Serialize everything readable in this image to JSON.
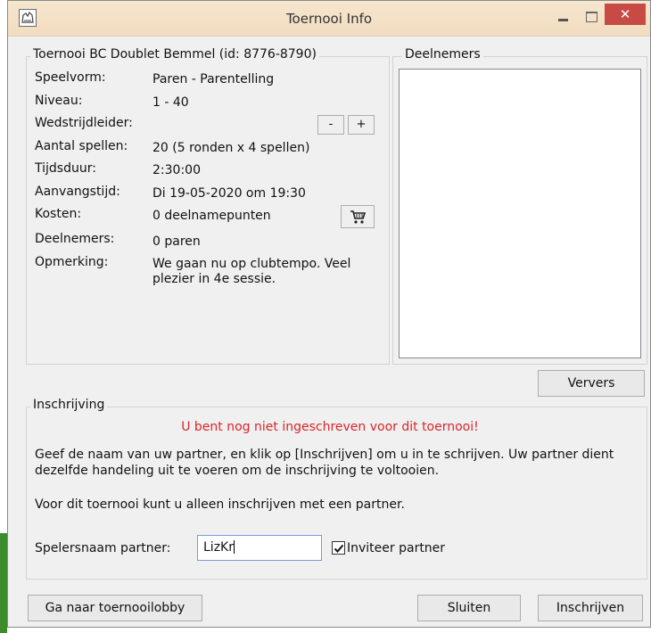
{
  "window": {
    "title": "Toernooi Info"
  },
  "info": {
    "legend": "Toernooi BC Doublet Bemmel (id: 8776-8790)",
    "rows": [
      {
        "label": "Speelvorm:",
        "value": "Paren - Parentelling"
      },
      {
        "label": "Niveau:",
        "value": "1 - 40"
      },
      {
        "label": "Wedstrijdleider:",
        "value": ""
      },
      {
        "label": "Aantal spellen:",
        "value": "20 (5 ronden x 4 spellen)"
      },
      {
        "label": "Tijdsduur:",
        "value": "2:30:00"
      },
      {
        "label": "Aanvangstijd:",
        "value": "Di 19-05-2020 om 19:30"
      },
      {
        "label": "Kosten:",
        "value": "0 deelnamepunten"
      },
      {
        "label": "Deelnemers:",
        "value": "0 paren"
      },
      {
        "label": "Opmerking:",
        "value": "We gaan nu op clubtempo. Veel plezier in 4e sessie."
      }
    ],
    "minus_label": "-",
    "plus_label": "+"
  },
  "participants": {
    "legend": "Deelnemers",
    "refresh_label": "Ververs"
  },
  "registration": {
    "legend": "Inschrijving",
    "warning": "U bent nog niet ingeschreven voor dit toernooi!",
    "instructions": "Geef de naam van uw partner, en klik op [Inschrijven] om u in te schrijven. Uw partner dient dezelfde handeling uit te voeren om de inschrijving te voltooien.",
    "note": "Voor dit toernooi kunt u alleen inschrijven met een partner.",
    "partner_label": "Spelersnaam partner:",
    "partner_value": "LizKr",
    "invite_label": "Inviteer partner",
    "invite_checked": true
  },
  "footer": {
    "lobby_label": "Ga naar toernooilobby",
    "close_label": "Sluiten",
    "register_label": "Inschrijven"
  },
  "colors": {
    "titlebar": "#f3e2c8",
    "close_button": "#c74b44",
    "warning_text": "#d9262b"
  },
  "icons": [
    "app-icon",
    "minimize-icon",
    "maximize-icon",
    "close-icon",
    "cart-icon",
    "checkmark-icon"
  ]
}
